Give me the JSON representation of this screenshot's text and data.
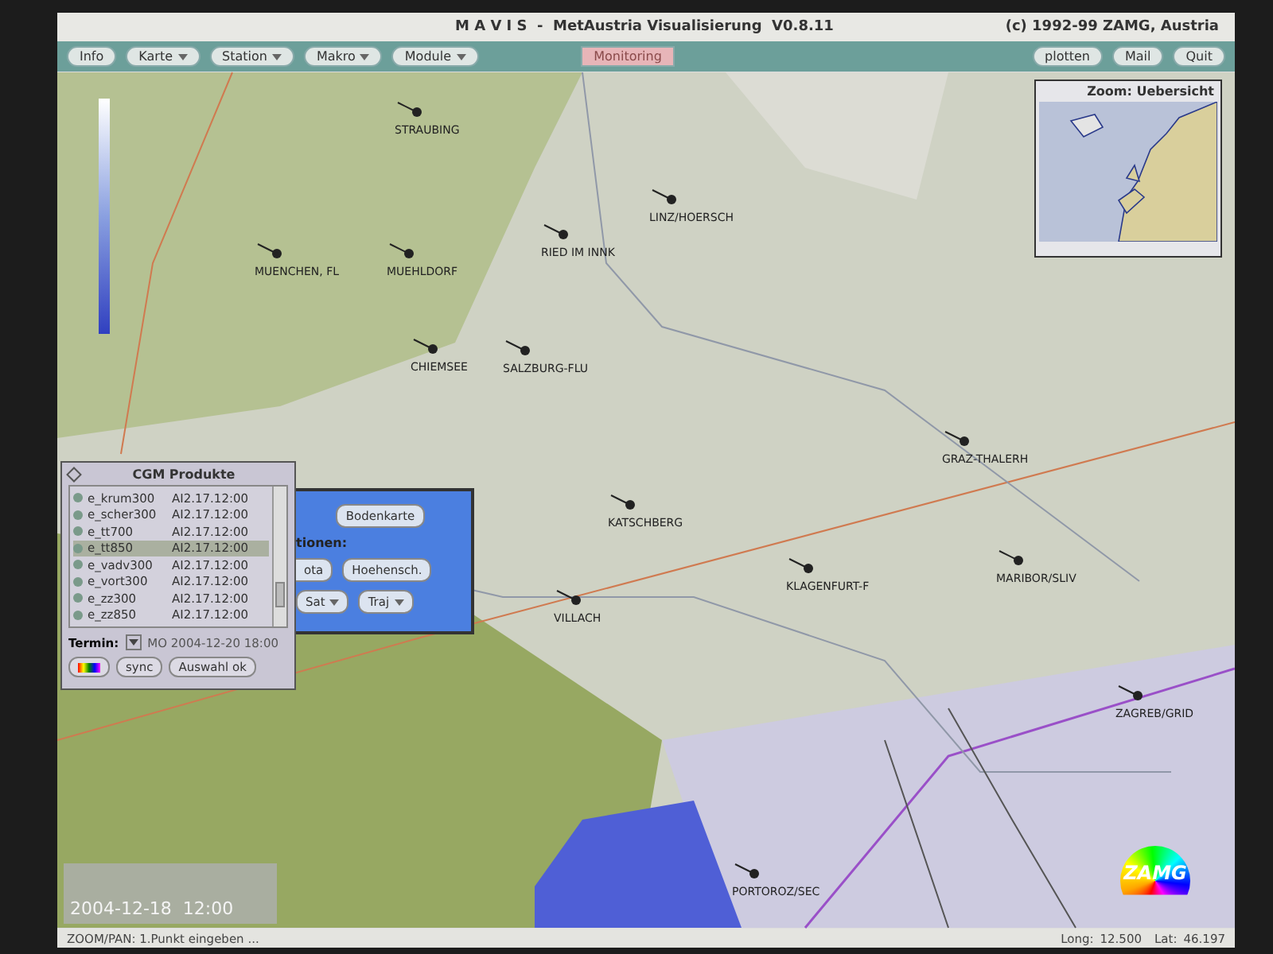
{
  "window": {
    "title": "M A V I S  -  MetAustria Visualisierung  V0.8.11",
    "copyright": "(c) 1992-99 ZAMG, Austria"
  },
  "menu_bar": {
    "left": [
      {
        "label": "Info",
        "dropdown": false
      },
      {
        "label": "Karte",
        "dropdown": true
      },
      {
        "label": "Station",
        "dropdown": true
      },
      {
        "label": "Makro",
        "dropdown": true
      },
      {
        "label": "Module",
        "dropdown": true
      }
    ],
    "center": [
      {
        "label": "Monitoring",
        "highlighted": true
      }
    ],
    "right": [
      {
        "label": "plotten",
        "dropdown": false
      },
      {
        "label": "Mail",
        "dropdown": false
      },
      {
        "label": "Quit",
        "dropdown": false
      }
    ]
  },
  "map": {
    "stations": [
      "STRAUBING",
      "MUENCHEN, FL",
      "MUEHLDORF",
      "RIED IM INNK",
      "LINZ/HOERSCH",
      "CHIEMSEE",
      "SALZBURG-FLU",
      "KATSCHBERG",
      "VILLACH",
      "KLAGENFURT-F",
      "GRAZ-THALERH",
      "MARIBOR/SLIV",
      "ZAGREB/GRID",
      "PORTOROZ/SEC"
    ],
    "overview": {
      "title": "Zoom: Uebersicht"
    },
    "time_box": {
      "text": "2004-12-18  12:00"
    },
    "logo": {
      "text": "ZAMG"
    }
  },
  "cgm_panel": {
    "title": "CGM Produkte",
    "products": [
      {
        "name": "e_krum300",
        "value": "AI2.17.12:00",
        "selected": false
      },
      {
        "name": "e_scher300",
        "value": "AI2.17.12:00",
        "selected": false
      },
      {
        "name": "e_tt700",
        "value": "AI2.17.12:00",
        "selected": false
      },
      {
        "name": "e_tt850",
        "value": "AI2.17.12:00",
        "selected": true
      },
      {
        "name": "e_vadv300",
        "value": "AI2.17.12:00",
        "selected": false
      },
      {
        "name": "e_vort300",
        "value": "AI2.17.12:00",
        "selected": false
      },
      {
        "name": "e_zz300",
        "value": "AI2.17.12:00",
        "selected": false
      },
      {
        "name": "e_zz850",
        "value": "AI2.17.12:00",
        "selected": false
      }
    ],
    "termin_label": "Termin:",
    "termin_value": "MO 2004-12-20 18:00",
    "buttons": [
      "sync",
      "Auswahl ok"
    ]
  },
  "blue_panel": {
    "top_button": "Bodenkarte",
    "label": "tionen:",
    "row_1": [
      {
        "label": "ota",
        "dropdown": false
      },
      {
        "label": "Hoehensch.",
        "dropdown": false
      }
    ],
    "row_2": [
      {
        "label": "Sat",
        "dropdown": true
      },
      {
        "label": "Traj",
        "dropdown": true
      }
    ]
  },
  "status_bar": {
    "message": "ZOOM/PAN: 1.Punkt eingeben ...",
    "coordinates": [
      {
        "label": "Long:",
        "value": "12.500"
      },
      {
        "label": "Lat:",
        "value": "46.197"
      }
    ]
  }
}
